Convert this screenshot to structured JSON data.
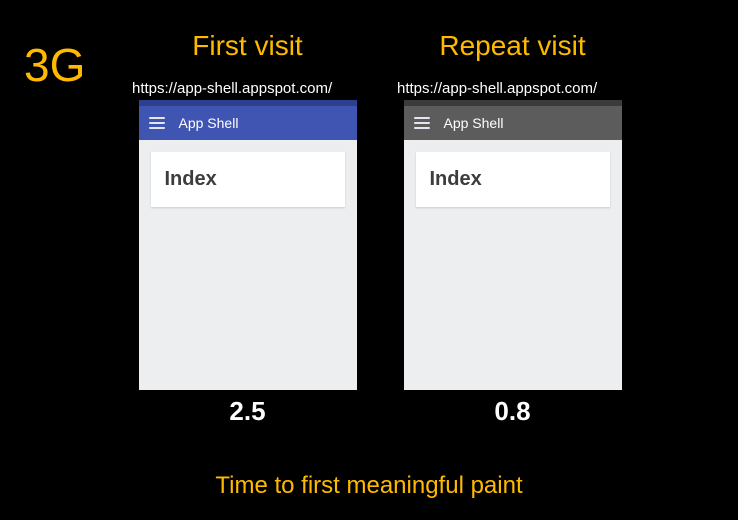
{
  "network_label": "3G",
  "caption": "Time to first meaningful paint",
  "columns": {
    "first": {
      "visit_label": "First visit",
      "url": "https://app-shell.appspot.com/",
      "toolbar_title": "App Shell",
      "card_title": "Index",
      "timing": "2.5"
    },
    "repeat": {
      "visit_label": "Repeat visit",
      "url": "https://app-shell.appspot.com/",
      "toolbar_title": "App Shell",
      "card_title": "Index",
      "timing": "0.8"
    }
  }
}
